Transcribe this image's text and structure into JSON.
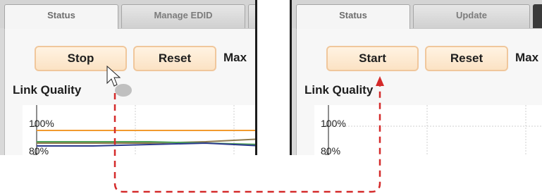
{
  "left": {
    "tabs": [
      "Status",
      "Manage EDID"
    ],
    "buttons": {
      "primary": "Stop",
      "reset": "Reset"
    },
    "max_label": "Max",
    "section_title": "Link Quality",
    "y_ticks": [
      "100%",
      "80%"
    ],
    "chart_data": {
      "type": "line",
      "ylabel": "",
      "y_ticks": [
        "100%",
        "80%"
      ],
      "series": [
        {
          "color": "#f29a2e",
          "values": [
            97,
            97,
            97,
            97,
            97
          ]
        },
        {
          "color": "#8c7a4e",
          "values": [
            88,
            88,
            88,
            89,
            91
          ]
        },
        {
          "color": "#4fa35a",
          "values": [
            89,
            89,
            89,
            88,
            87
          ]
        },
        {
          "color": "#2c3a8c",
          "values": [
            86,
            86,
            87,
            88,
            86
          ]
        }
      ]
    }
  },
  "right": {
    "tabs": [
      "Status",
      "Update"
    ],
    "buttons": {
      "primary": "Start",
      "reset": "Reset"
    },
    "max_label": "Max",
    "section_title": "Link Quality",
    "y_ticks": [
      "100%",
      "80%"
    ]
  },
  "colors": {
    "arrow": "#d42a2a",
    "button_border": "#f0c79c",
    "button_fill": "#fbe2c4"
  },
  "icons": {
    "cursor": "mouse-pointer-icon",
    "arrow": "dashed-arrow-icon"
  }
}
